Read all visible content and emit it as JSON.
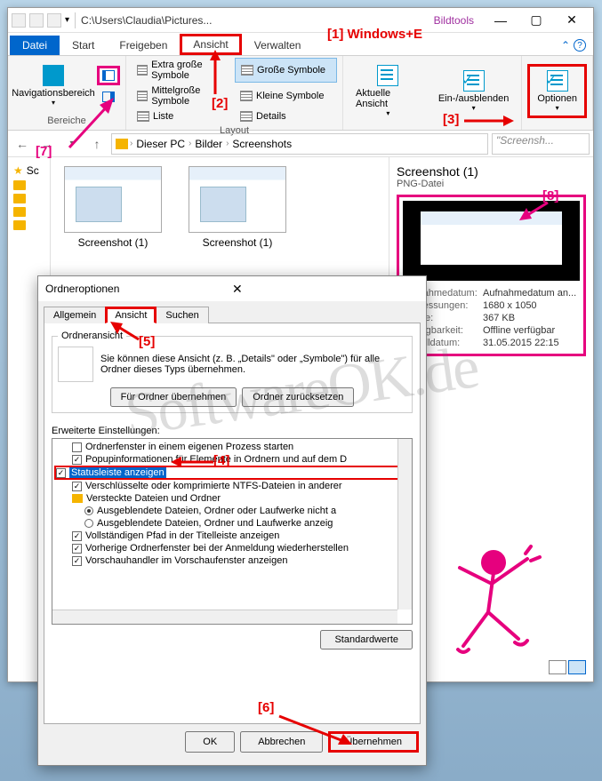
{
  "titlebar": {
    "path": "C:\\Users\\Claudia\\Pictures...",
    "tools": "Bildtools"
  },
  "winbtns": {
    "min": "—",
    "max": "▢",
    "close": "✕"
  },
  "tabs": {
    "datei": "Datei",
    "start": "Start",
    "freigeben": "Freigeben",
    "ansicht": "Ansicht",
    "verwalten": "Verwalten"
  },
  "ribbon": {
    "nav": "Navigationsbereich",
    "panes_label": "Bereiche",
    "layout": {
      "xl": "Extra große Symbole",
      "lg": "Große Symbole",
      "md": "Mittelgroße Symbole",
      "sm": "Kleine Symbole",
      "list": "Liste",
      "details": "Details",
      "label": "Layout"
    },
    "curview": {
      "aktuelle": "Aktuelle Ansicht",
      "einaus": "Ein-/ausblenden"
    },
    "options": "Optionen"
  },
  "breadcrumbs": {
    "pc": "Dieser PC",
    "bilder": "Bilder",
    "screenshots": "Screenshots"
  },
  "search_placeholder": "\"Screensh...",
  "thumbs": {
    "t1": "Screenshot (1)",
    "t2": "Screenshot (1)"
  },
  "sidebar": {
    "schnell": "Sc"
  },
  "preview": {
    "title": "Screenshot (1)",
    "type": "PNG-Datei",
    "meta": {
      "aufnahme_k": "Aufnahmedatum:",
      "aufnahme_v": "Aufnahmedatum an...",
      "abmess_k": "Abmessungen:",
      "abmess_v": "1680 x 1050",
      "groesse_k": "Größe:",
      "groesse_v": "367 KB",
      "verf_k": "Verfügbarkeit:",
      "verf_v": "Offline verfügbar",
      "erstell_k": "Erstelldatum:",
      "erstell_v": "31.05.2015 22:15"
    }
  },
  "dialog": {
    "title": "Ordneroptionen",
    "tabs": {
      "allgemein": "Allgemein",
      "ansicht": "Ansicht",
      "suchen": "Suchen"
    },
    "fv": {
      "legend": "Ordneransicht",
      "text": "Sie können diese Ansicht (z. B. „Details\" oder „Symbole\") für alle Ordner dieses Typs übernehmen.",
      "apply": "Für Ordner übernehmen",
      "reset": "Ordner zurücksetzen"
    },
    "adv_label": "Erweiterte Einstellungen:",
    "tree": {
      "i1": "Ordnerfenster in einem eigenen Prozess starten",
      "i2": "Popupinformationen für Elemente in Ordnern und auf dem D",
      "i3": "Statusleiste anzeigen",
      "i4": "Verschlüsselte oder komprimierte NTFS-Dateien in anderer",
      "i5": "Versteckte Dateien und Ordner",
      "i6": "Ausgeblendete Dateien, Ordner oder Laufwerke nicht a",
      "i7": "Ausgeblendete Dateien, Ordner und Laufwerke anzeig",
      "i8": "Vollständigen Pfad in der Titelleiste anzeigen",
      "i9": "Vorherige Ordnerfenster bei der Anmeldung wiederherstellen",
      "i10": "Vorschauhandler im Vorschaufenster anzeigen"
    },
    "defaults": "Standardwerte",
    "ok": "OK",
    "cancel": "Abbrechen",
    "apply": "Übernehmen"
  },
  "anno": {
    "a1": "[1] Windows+E",
    "a2": "[2]",
    "a3": "[3]",
    "a4": "[4]",
    "a5": "[5]",
    "a6": "[6]",
    "a7": "[7]",
    "a8": "[8]"
  }
}
